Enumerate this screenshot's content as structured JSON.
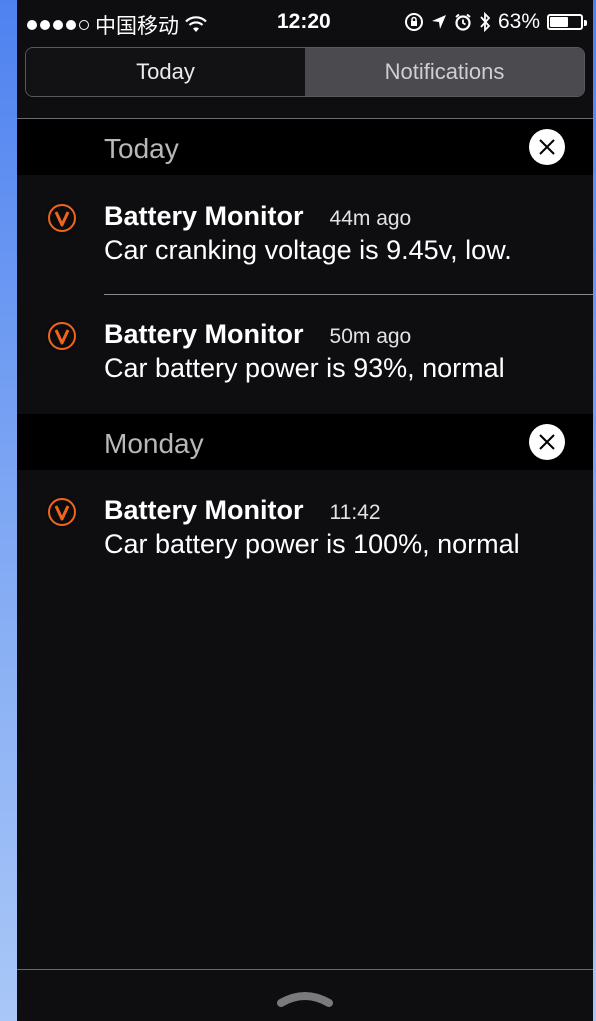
{
  "status_bar": {
    "carrier": "中国移动",
    "time": "12:20",
    "battery_percent": "63%",
    "battery_level": 0.63
  },
  "segments": {
    "today": "Today",
    "notifications": "Notifications"
  },
  "sections": [
    {
      "title": "Today",
      "notifications": [
        {
          "app": "Battery Monitor",
          "time": "44m ago",
          "message": "Car cranking voltage is 9.45v, low."
        },
        {
          "app": "Battery Monitor",
          "time": "50m ago",
          "message": "Car battery power is 93%, normal"
        }
      ]
    },
    {
      "title": "Monday",
      "notifications": [
        {
          "app": "Battery Monitor",
          "time": "11:42",
          "message": "Car battery power is 100%, normal"
        }
      ]
    }
  ],
  "colors": {
    "accent": "#f0641e",
    "background": "#0e0e10",
    "header": "#000000"
  },
  "icons": {
    "app_icon": "battery-monitor-v-icon",
    "clear": "close-icon",
    "grabber": "chevron-up-icon"
  }
}
